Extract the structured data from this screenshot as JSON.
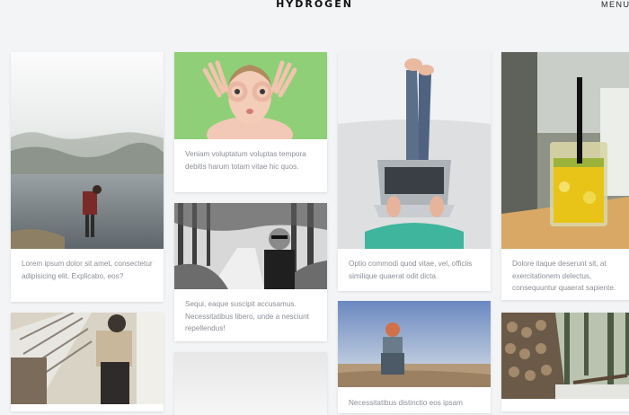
{
  "header": {
    "logo": "HYDROGEN",
    "menu_label": "MENU"
  },
  "cards": [
    {
      "caption": "Lorem ipsum dolor sit amet, consectetur adipisicing elit. Explicabo, eos?"
    },
    {
      "caption": "Veniam voluptatum voluptas tempora debitis harum totam vitae hic quos."
    },
    {
      "caption": "Sequi, eaque suscipit accusamus. Necessitatibus libero, unde a nesciunt repellendus!"
    },
    {
      "caption": "Optio commodi quod vitae, vel, officiis similique quaerat odit dicta."
    },
    {
      "caption": "Necessitatibus distinctio eos ipsam"
    },
    {
      "caption": "Dolore itaque deserunt sit, at exercitationem delectus, consequuntur quaerat sapiente."
    }
  ]
}
